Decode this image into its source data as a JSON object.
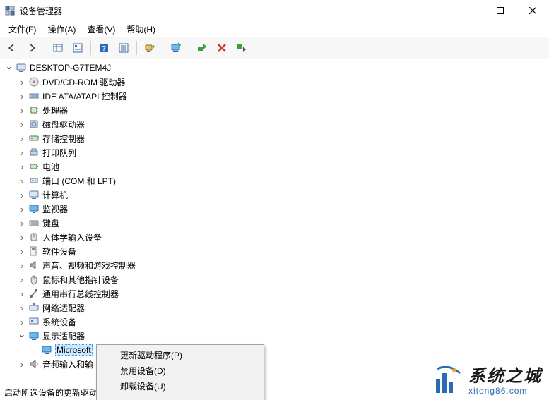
{
  "window": {
    "title": "设备管理器"
  },
  "menubar": [
    "文件(F)",
    "操作(A)",
    "查看(V)",
    "帮助(H)"
  ],
  "tree": {
    "root": "DESKTOP-G7TEM4J",
    "categories": [
      {
        "label": "DVD/CD-ROM 驱动器",
        "icon": "disc"
      },
      {
        "label": "IDE ATA/ATAPI 控制器",
        "icon": "ide"
      },
      {
        "label": "处理器",
        "icon": "cpu"
      },
      {
        "label": "磁盘驱动器",
        "icon": "disk"
      },
      {
        "label": "存储控制器",
        "icon": "storage"
      },
      {
        "label": "打印队列",
        "icon": "printer"
      },
      {
        "label": "电池",
        "icon": "battery"
      },
      {
        "label": "端口 (COM 和 LPT)",
        "icon": "port"
      },
      {
        "label": "计算机",
        "icon": "computer"
      },
      {
        "label": "监视器",
        "icon": "monitor"
      },
      {
        "label": "键盘",
        "icon": "keyboard"
      },
      {
        "label": "人体学输入设备",
        "icon": "hid"
      },
      {
        "label": "软件设备",
        "icon": "software"
      },
      {
        "label": "声音、视频和游戏控制器",
        "icon": "sound"
      },
      {
        "label": "鼠标和其他指针设备",
        "icon": "mouse"
      },
      {
        "label": "通用串行总线控制器",
        "icon": "usb"
      },
      {
        "label": "网络适配器",
        "icon": "network"
      },
      {
        "label": "系统设备",
        "icon": "system"
      },
      {
        "label": "显示适配器",
        "icon": "display",
        "expanded": true,
        "children": [
          {
            "label": "Microsoft 基本显示适配器",
            "icon": "display",
            "selected": true,
            "label_visible": "Microsoft"
          }
        ]
      },
      {
        "label": "音频输入和输",
        "icon": "audio"
      }
    ]
  },
  "context_menu": [
    "更新驱动程序(P)",
    "禁用设备(D)",
    "卸载设备(U)"
  ],
  "statusbar": "启动所选设备的更新驱动",
  "watermark": {
    "text": "系统之城",
    "url": "xitong86.com"
  }
}
